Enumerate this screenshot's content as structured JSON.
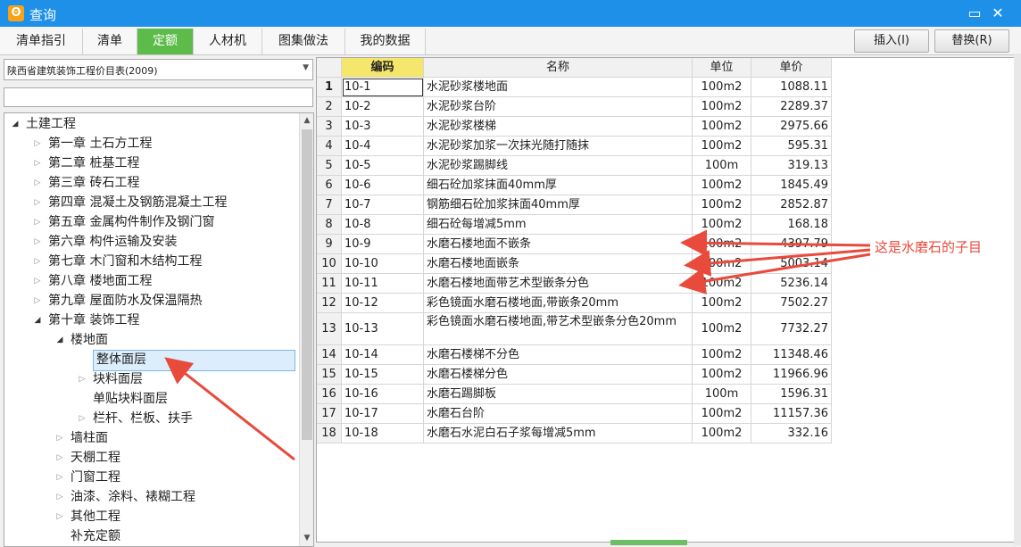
{
  "window": {
    "title": "查询"
  },
  "tabs": [
    "清单指引",
    "清单",
    "定额",
    "人材机",
    "图集做法",
    "我的数据"
  ],
  "active_tab": 2,
  "buttons": {
    "insert": "插入(I)",
    "replace": "替换(R)"
  },
  "library_select": {
    "value": "陕西省建筑装饰工程价目表(2009)"
  },
  "tree": [
    {
      "label": "土建工程",
      "level": 0,
      "toggle": "open"
    },
    {
      "label": "第一章 土石方工程",
      "level": 1,
      "toggle": "closed"
    },
    {
      "label": "第二章 桩基工程",
      "level": 1,
      "toggle": "closed"
    },
    {
      "label": "第三章 砖石工程",
      "level": 1,
      "toggle": "closed"
    },
    {
      "label": "第四章 混凝土及钢筋混凝土工程",
      "level": 1,
      "toggle": "closed"
    },
    {
      "label": "第五章 金属构件制作及钢门窗",
      "level": 1,
      "toggle": "closed"
    },
    {
      "label": "第六章 构件运输及安装",
      "level": 1,
      "toggle": "closed"
    },
    {
      "label": "第七章 木门窗和木结构工程",
      "level": 1,
      "toggle": "closed"
    },
    {
      "label": "第八章 楼地面工程",
      "level": 1,
      "toggle": "closed"
    },
    {
      "label": "第九章 屋面防水及保温隔热",
      "level": 1,
      "toggle": "closed"
    },
    {
      "label": "第十章 装饰工程",
      "level": 1,
      "toggle": "open"
    },
    {
      "label": "楼地面",
      "level": 2,
      "toggle": "open"
    },
    {
      "label": "整体面层",
      "level": 3,
      "toggle": "none",
      "selected": true
    },
    {
      "label": "块料面层",
      "level": 3,
      "toggle": "closed"
    },
    {
      "label": "单贴块料面层",
      "level": 3,
      "toggle": "none"
    },
    {
      "label": "栏杆、栏板、扶手",
      "level": 3,
      "toggle": "closed"
    },
    {
      "label": "墙柱面",
      "level": 2,
      "toggle": "closed"
    },
    {
      "label": "天棚工程",
      "level": 2,
      "toggle": "closed"
    },
    {
      "label": "门窗工程",
      "level": 2,
      "toggle": "closed"
    },
    {
      "label": "油漆、涂料、裱糊工程",
      "level": 2,
      "toggle": "closed"
    },
    {
      "label": "其他工程",
      "level": 2,
      "toggle": "closed"
    },
    {
      "label": "补充定额",
      "level": 2,
      "toggle": "none"
    }
  ],
  "grid": {
    "columns": [
      "编码",
      "名称",
      "单位",
      "单价"
    ],
    "rows": [
      {
        "n": "1",
        "code": "10-1",
        "name": "水泥砂浆楼地面",
        "unit": "100m2",
        "price": "1088.11"
      },
      {
        "n": "2",
        "code": "10-2",
        "name": "水泥砂浆台阶",
        "unit": "100m2",
        "price": "2289.37"
      },
      {
        "n": "3",
        "code": "10-3",
        "name": "水泥砂浆楼梯",
        "unit": "100m2",
        "price": "2975.66"
      },
      {
        "n": "4",
        "code": "10-4",
        "name": "水泥砂浆加浆一次抹光随打随抹",
        "unit": "100m2",
        "price": "595.31"
      },
      {
        "n": "5",
        "code": "10-5",
        "name": "水泥砂浆踢脚线",
        "unit": "100m",
        "price": "319.13"
      },
      {
        "n": "6",
        "code": "10-6",
        "name": "细石砼加浆抹面40mm厚",
        "unit": "100m2",
        "price": "1845.49"
      },
      {
        "n": "7",
        "code": "10-7",
        "name": "钢筋细石砼加浆抹面40mm厚",
        "unit": "100m2",
        "price": "2852.87"
      },
      {
        "n": "8",
        "code": "10-8",
        "name": "细石砼每增减5mm",
        "unit": "100m2",
        "price": "168.18"
      },
      {
        "n": "9",
        "code": "10-9",
        "name": "水磨石楼地面不嵌条",
        "unit": "100m2",
        "price": "4397.79"
      },
      {
        "n": "10",
        "code": "10-10",
        "name": "水磨石楼地面嵌条",
        "unit": "100m2",
        "price": "5003.14"
      },
      {
        "n": "11",
        "code": "10-11",
        "name": "水磨石楼地面带艺术型嵌条分色",
        "unit": "100m2",
        "price": "5236.14"
      },
      {
        "n": "12",
        "code": "10-12",
        "name": "彩色镜面水磨石楼地面,带嵌条20mm",
        "unit": "100m2",
        "price": "7502.27"
      },
      {
        "n": "13",
        "code": "10-13",
        "name": "彩色镜面水磨石楼地面,带艺术型嵌条分色20mm",
        "unit": "100m2",
        "price": "7732.27"
      },
      {
        "n": "14",
        "code": "10-14",
        "name": "水磨石楼梯不分色",
        "unit": "100m2",
        "price": "11348.46"
      },
      {
        "n": "15",
        "code": "10-15",
        "name": "水磨石楼梯分色",
        "unit": "100m2",
        "price": "11966.96"
      },
      {
        "n": "16",
        "code": "10-16",
        "name": "水磨石踢脚板",
        "unit": "100m",
        "price": "1596.31"
      },
      {
        "n": "17",
        "code": "10-17",
        "name": "水磨石台阶",
        "unit": "100m2",
        "price": "11157.36"
      },
      {
        "n": "18",
        "code": "10-18",
        "name": "水磨石水泥白石子浆每增减5mm",
        "unit": "100m2",
        "price": "332.16"
      }
    ]
  },
  "annotation": {
    "text": "这是水磨石的子目",
    "color": "#e84a3c"
  }
}
